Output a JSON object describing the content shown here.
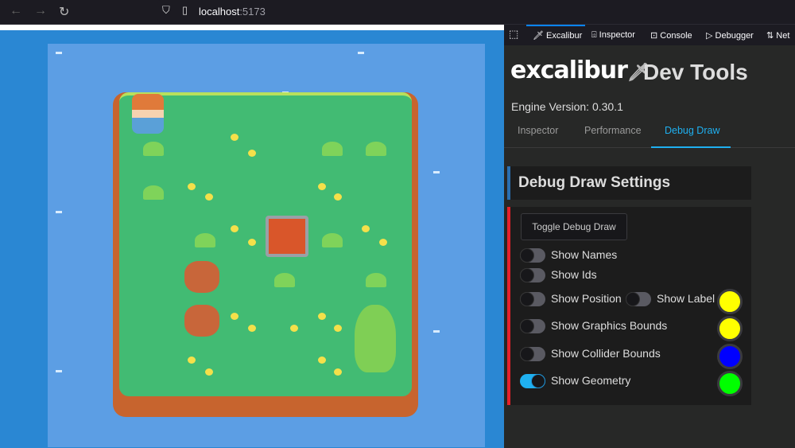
{
  "browser": {
    "url_host": "localhost",
    "url_port": ":5173",
    "icons": [
      "back-icon",
      "forward-icon",
      "reload-icon",
      "shield-icon",
      "page-icon"
    ]
  },
  "devtools_tabs": [
    {
      "label": "Excalibur",
      "icon": "sword-icon"
    },
    {
      "label": "Inspector",
      "icon": "inspector-icon"
    },
    {
      "label": "Console",
      "icon": "console-icon"
    },
    {
      "label": "Debugger",
      "icon": "debugger-icon"
    },
    {
      "label": "Net",
      "icon": "network-icon"
    }
  ],
  "panel": {
    "logo": "excalibur",
    "title": "Dev Tools",
    "engine_version": "Engine Version: 0.30.1",
    "tabs": [
      "Inspector",
      "Performance",
      "Debug Draw"
    ],
    "active_tab": "Debug Draw",
    "section_title": "Debug Draw Settings",
    "toggle_button": "Toggle Debug Draw",
    "options": [
      {
        "label": "Show Names",
        "on": false
      },
      {
        "label": "Show Ids",
        "on": false
      },
      {
        "label": "Show Position",
        "on": false,
        "color": "#ffff00"
      },
      {
        "label": "Show Label",
        "on": false
      },
      {
        "label": "Show Graphics Bounds",
        "on": false,
        "color": "#ffff00"
      },
      {
        "label": "Show Collider Bounds",
        "on": false,
        "color": "#0000ff"
      },
      {
        "label": "Show Geometry",
        "on": true,
        "color": "#00ff00"
      }
    ]
  },
  "colors": {
    "accent": "#1fb0f0",
    "section_bar": "#e8202a",
    "header_bar": "#2a6fb0"
  }
}
